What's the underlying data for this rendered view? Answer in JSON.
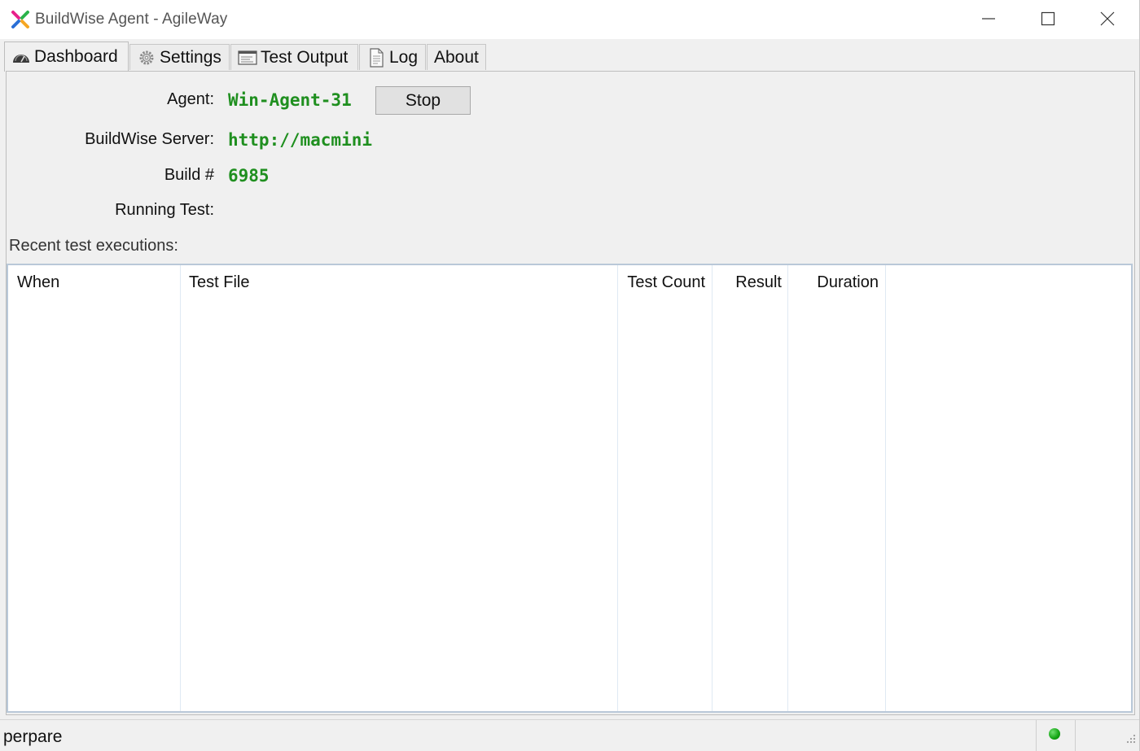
{
  "window": {
    "title": "BuildWise Agent - AgileWay"
  },
  "tabs": [
    {
      "label": "Dashboard",
      "icon": "dashboard-gauge-icon"
    },
    {
      "label": "Settings",
      "icon": "gear-icon"
    },
    {
      "label": "Test Output",
      "icon": "terminal-window-icon"
    },
    {
      "label": "Log",
      "icon": "document-icon"
    },
    {
      "label": "About",
      "icon": ""
    }
  ],
  "active_tab": "Dashboard",
  "dashboard": {
    "agent_label": "Agent:",
    "agent_value": "Win-Agent-31",
    "stop_label": "Stop",
    "server_label": "BuildWise Server:",
    "server_value": "http://macmini",
    "build_label": "Build #",
    "build_value": "6985",
    "running_label": "Running Test:",
    "running_value": "",
    "recent_label": "Recent test executions:"
  },
  "table": {
    "columns": [
      "When",
      "Test File",
      "Test Count",
      "Result",
      "Duration"
    ],
    "rows": []
  },
  "status": {
    "text": "perpare",
    "indicator_color": "#13a313"
  },
  "colors": {
    "value_green": "#1f8f1f"
  }
}
